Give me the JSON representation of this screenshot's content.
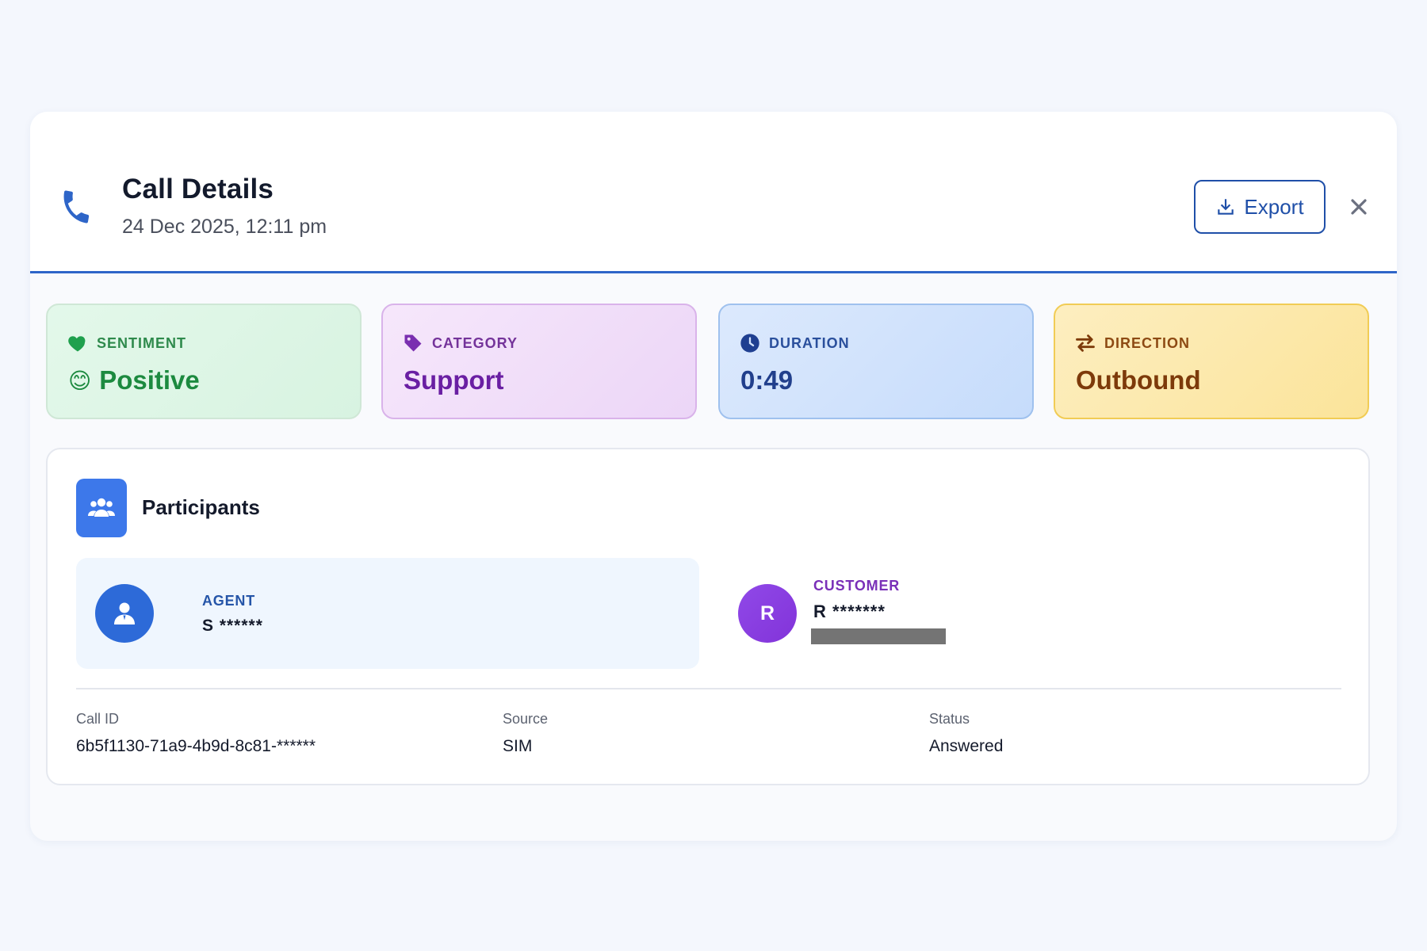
{
  "header": {
    "title": "Call Details",
    "subtitle": "24 Dec 2025, 12:11 pm",
    "export_label": "Export",
    "phone_icon": "phone-icon",
    "close_icon": "close-icon",
    "accent_color": "#2e65c8"
  },
  "stats": {
    "sentiment": {
      "label": "SENTIMENT",
      "value": "Positive",
      "emoji": "😊",
      "icon": "heart-icon",
      "color": "#1c8a3f"
    },
    "category": {
      "label": "CATEGORY",
      "value": "Support",
      "icon": "tag-icon",
      "color": "#6a1fa3"
    },
    "duration": {
      "label": "DURATION",
      "value": "0:49",
      "icon": "clock-icon",
      "color": "#213f8c"
    },
    "direction": {
      "label": "DIRECTION",
      "value": "Outbound",
      "icon": "swap-arrows-icon",
      "color": "#7d3a0a"
    }
  },
  "participants": {
    "title": "Participants",
    "icon": "users-icon",
    "agent": {
      "role": "AGENT",
      "name": "S ******"
    },
    "customer": {
      "role": "CUSTOMER",
      "initial": "R",
      "name": "R *******"
    }
  },
  "meta": {
    "call_id": {
      "label": "Call ID",
      "value": "6b5f1130-71a9-4b9d-8c81-******"
    },
    "source": {
      "label": "Source",
      "value": "SIM"
    },
    "status": {
      "label": "Status",
      "value": "Answered"
    }
  }
}
